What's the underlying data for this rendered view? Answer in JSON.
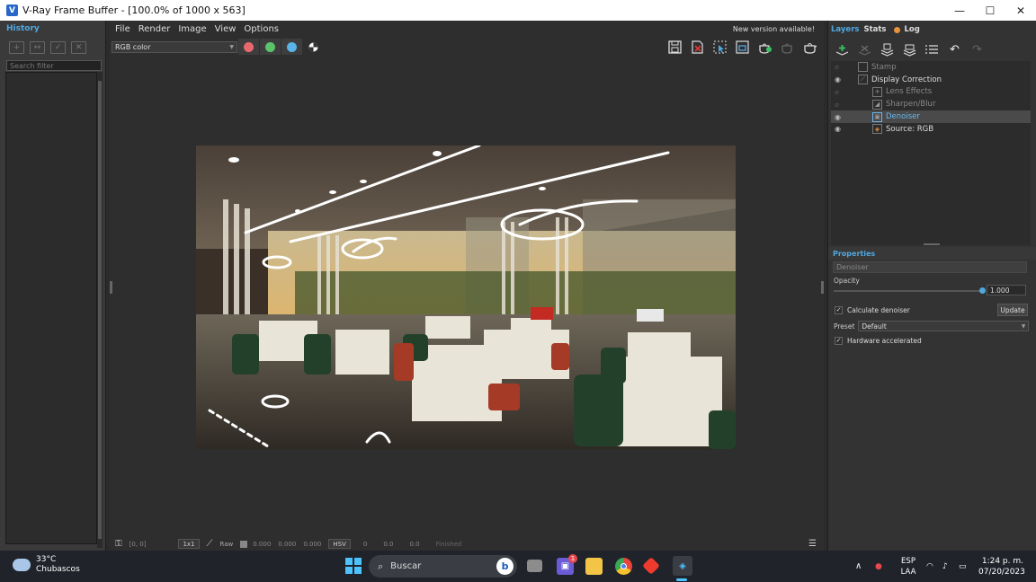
{
  "window": {
    "title": "V-Ray Frame Buffer - [100.0% of 1000 x 563]",
    "app_icon": "V",
    "minimize": "—",
    "maximize": "☐",
    "close": "✕"
  },
  "history": {
    "title": "History",
    "search_placeholder": "Search filter"
  },
  "menu": {
    "items": [
      "File",
      "Render",
      "Image",
      "View",
      "Options"
    ],
    "new_version": "New version available!"
  },
  "toolbar": {
    "channel": "RGB color",
    "channel_colors": {
      "red": "#e8696d",
      "green": "#5ac46a",
      "blue": "#5ab4e8"
    }
  },
  "statusbar": {
    "coords": "[0, 0]",
    "zoom": "1x1",
    "raw_label": "Raw",
    "raw_values": [
      "0.000",
      "0.000",
      "0.000"
    ],
    "color_mode": "HSV",
    "hsv_values": [
      "0",
      "0.0",
      "0.0"
    ],
    "status": "Finished"
  },
  "right_panel": {
    "tabs": [
      "Layers",
      "Stats",
      "Log"
    ],
    "layers": [
      {
        "name": "Stamp",
        "visible": false
      },
      {
        "name": "Display Correction",
        "visible": true
      },
      {
        "name": "Lens Effects",
        "visible": false
      },
      {
        "name": "Sharpen/Blur",
        "visible": false
      },
      {
        "name": "Denoiser",
        "visible": true,
        "selected": true
      },
      {
        "name": "Source: RGB",
        "visible": true
      }
    ],
    "properties_title": "Properties",
    "selected_layer": "Denoiser",
    "opacity_label": "Opacity",
    "opacity_value": "1.000",
    "opacity_fraction": 1.0,
    "calculate_label": "Calculate denoiser",
    "update_label": "Update",
    "preset_label": "Preset",
    "preset_value": "Default",
    "hardware_label": "Hardware accelerated"
  },
  "taskbar": {
    "temperature": "33°C",
    "weather": "Chubascos",
    "search_label": "Buscar",
    "teams_badge": "1",
    "language": "ESP",
    "layout": "LAA",
    "time": "1:24 p. m.",
    "date": "07/20/2023"
  }
}
